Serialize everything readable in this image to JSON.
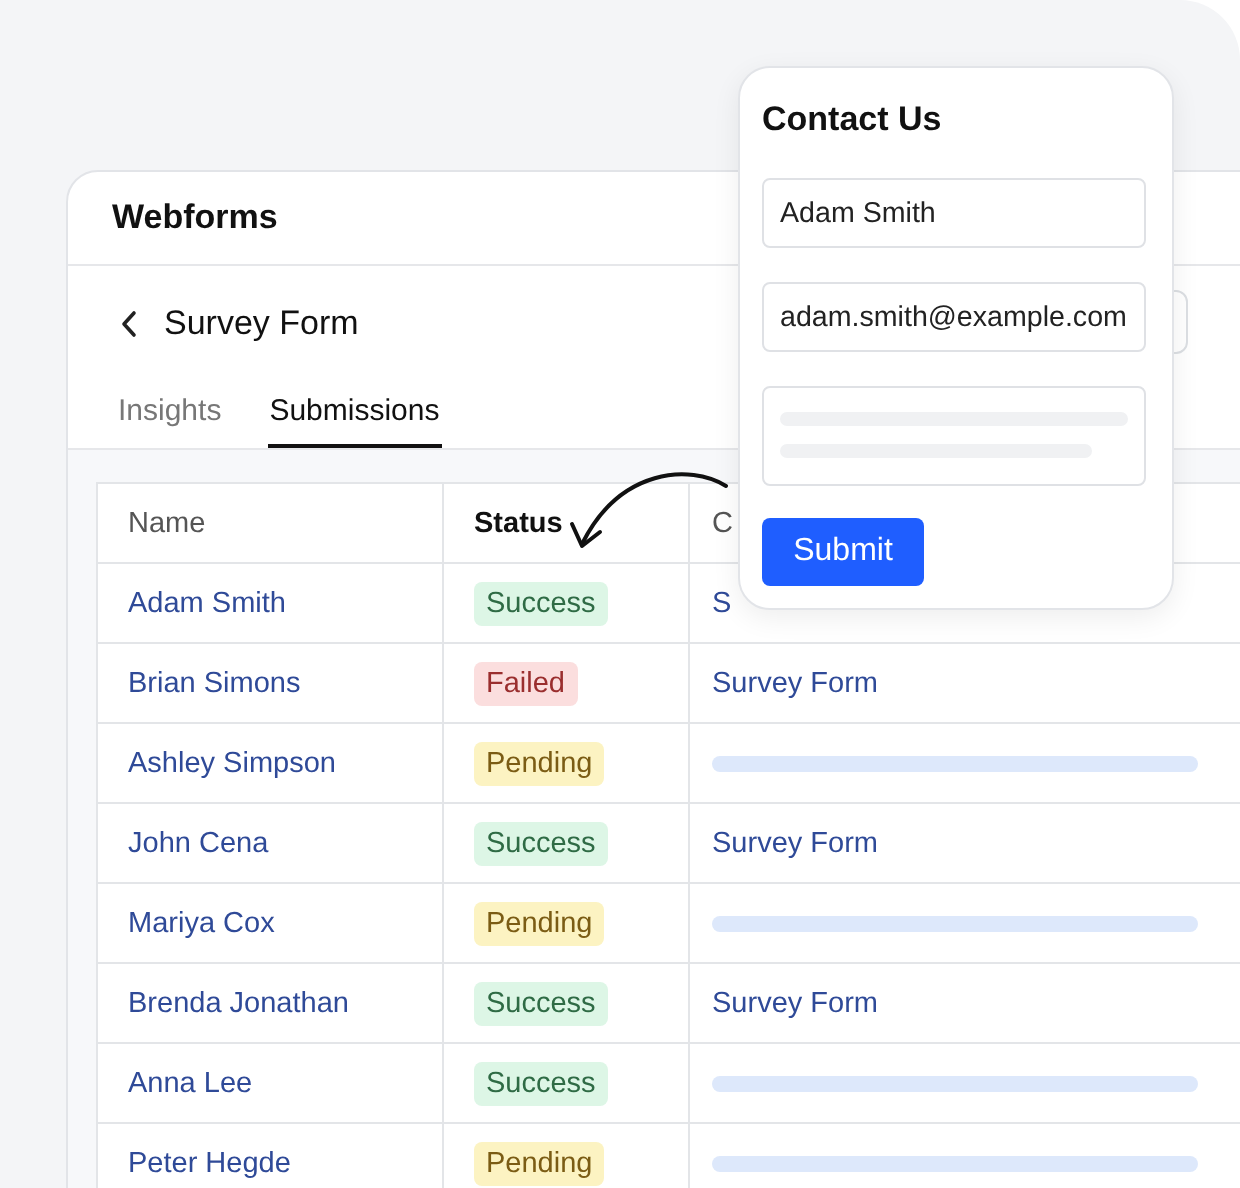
{
  "app": {
    "title": "Webforms"
  },
  "form": {
    "title": "Survey Form"
  },
  "tabs": [
    {
      "label": "Insights",
      "selected": false
    },
    {
      "label": "Submissions",
      "selected": true
    }
  ],
  "table": {
    "columns": [
      {
        "label": "Name",
        "active": false
      },
      {
        "label": "Status",
        "active": true
      },
      {
        "label": "C",
        "active": false
      }
    ],
    "rows": [
      {
        "name": "Adam Smith",
        "status": "Success",
        "color": "#ddf6e6",
        "column_3": {
          "kind": "text",
          "text": "S"
        }
      },
      {
        "name": "Brian Simons",
        "status": "Failed",
        "color": "#fbdede",
        "column_3": {
          "kind": "text",
          "text": "Survey Form"
        }
      },
      {
        "name": "Ashley Simpson",
        "status": "Pending",
        "color": "#fcf3c2",
        "column_3": {
          "kind": "skeleton"
        }
      },
      {
        "name": "John Cena",
        "status": "Success",
        "color": "#ddf6e6",
        "column_3": {
          "kind": "text",
          "text": "Survey Form"
        }
      },
      {
        "name": "Mariya Cox",
        "status": "Pending",
        "color": "#fcf3c2",
        "column_3": {
          "kind": "skeleton"
        }
      },
      {
        "name": "Brenda Jonathan",
        "status": "Success",
        "color": "#ddf6e6",
        "column_3": {
          "kind": "text",
          "text": "Survey Form"
        }
      },
      {
        "name": "Anna Lee",
        "status": "Success",
        "color": "#ddf6e6",
        "column_3": {
          "kind": "skeleton"
        }
      },
      {
        "name": "Peter Hegde",
        "status": "Pending",
        "color": "#fcf3c2",
        "column_3": {
          "kind": "skeleton"
        }
      }
    ]
  },
  "popup": {
    "title": "Contact Us",
    "fields": [
      {
        "kind": "input",
        "value": "Adam Smith"
      },
      {
        "kind": "input",
        "value": "adam.smith@example.com"
      },
      {
        "kind": "textarea"
      }
    ],
    "button": "Submit"
  }
}
